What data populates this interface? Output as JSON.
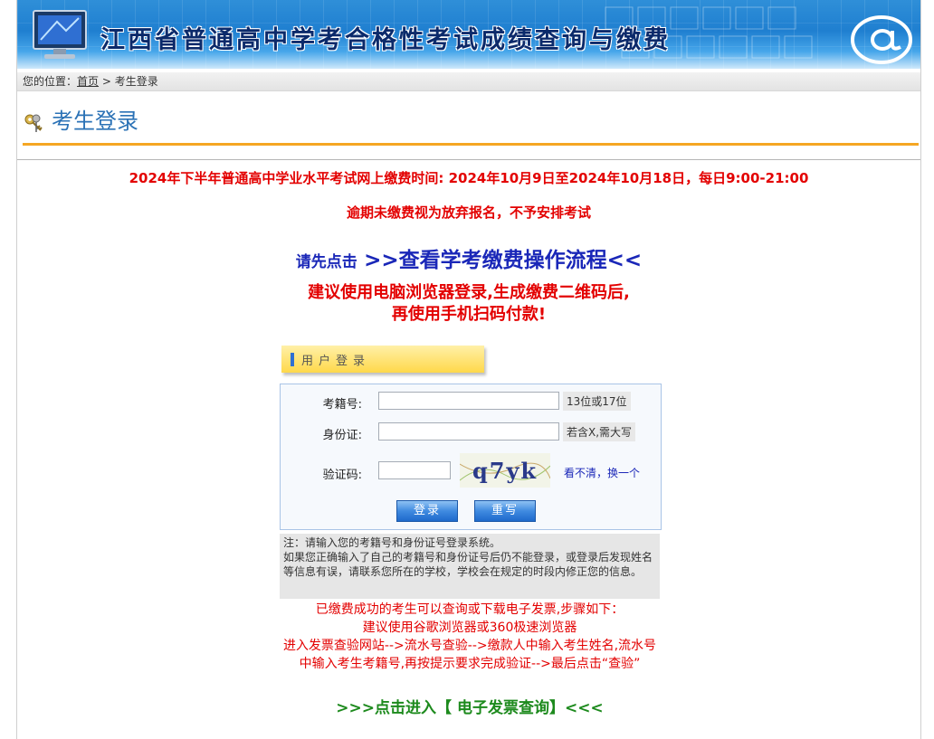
{
  "header": {
    "title": "江西省普通高中学考合格性考试成绩查询与缴费"
  },
  "breadcrumb": {
    "prefix": "您的位置：",
    "home": "首页",
    "separator": ">",
    "current": "考生登录"
  },
  "page_title": "考生登录",
  "notices": {
    "payment_time": "2024年下半年普通高中学业水平考试网上缴费时间: 2024年10月9日至2024年10月18日，每日9:00-21:00",
    "overdue": "逾期未缴费视为放弃报名，不予安排考试",
    "click_prefix": "请先点击",
    "process_link": ">>查看学考缴费操作流程<<",
    "browser_line1": "建议使用电脑浏览器登录,生成缴费二维码后,",
    "browser_line2": "再使用手机扫码付款!"
  },
  "login": {
    "header": "用户登录",
    "student_id_label": "考籍号:",
    "student_id_hint": "13位或17位",
    "id_card_label": "身份证:",
    "id_card_hint": "若含X,需大写",
    "captcha_label": "验证码:",
    "captcha_text": "q7yk",
    "refresh_prefix": "看不清，",
    "refresh_link": "换一个",
    "login_button": "登录",
    "reset_button": "重写"
  },
  "note": {
    "line1": "注：请输入您的考籍号和身份证号登录系统。",
    "line2": "如果您正确输入了自己的考籍号和身份证号后仍不能登录，或登录后发现姓名等信息有误，请联系您所在的学校，学校会在规定的时段内修正您的信息。"
  },
  "invoice": {
    "line1": "已缴费成功的考生可以查询或下载电子发票,步骤如下：",
    "line2": "建议使用谷歌浏览器或360极速浏览器",
    "line3": "进入发票查验网站-->流水号查验-->缴款人中输入考生姓名,流水号中输入考生考籍号,再按提示要求完成验证-->最后点击“查验”",
    "link": ">>>点击进入【 电子发票查询】<<<"
  },
  "colors": {
    "banner": "#1f7fd0",
    "accent_orange": "#f5a623",
    "notice_red": "#e30000",
    "link_blue": "#1a27b8",
    "invoice_green": "#1d8a1d"
  }
}
